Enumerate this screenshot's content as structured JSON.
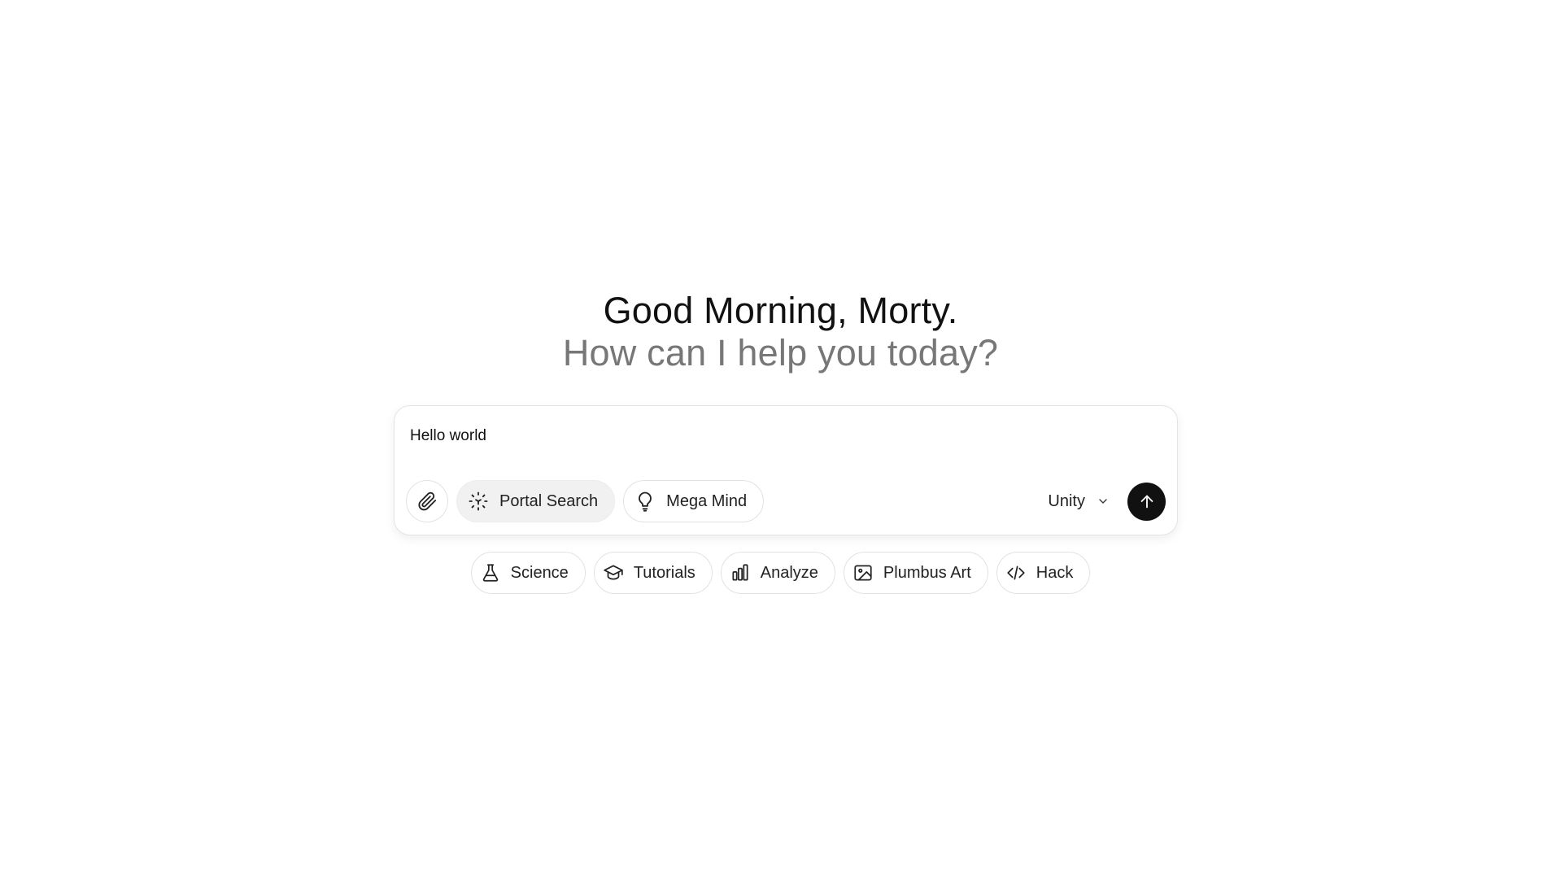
{
  "greeting": {
    "title": "Good Morning, Morty.",
    "subtitle": "How can I help you today?"
  },
  "composer": {
    "input_value": "Hello world",
    "attach_icon": "paperclip-icon",
    "tools": [
      {
        "label": "Portal Search",
        "icon": "portal-search-icon",
        "active": true
      },
      {
        "label": "Mega Mind",
        "icon": "lightbulb-icon",
        "active": false
      }
    ],
    "model": {
      "selected": "Unity",
      "icon": "chevron-down-icon"
    },
    "send_icon": "arrow-up-icon"
  },
  "suggestions": [
    {
      "label": "Science",
      "icon": "flask-icon"
    },
    {
      "label": "Tutorials",
      "icon": "graduation-cap-icon"
    },
    {
      "label": "Analyze",
      "icon": "bar-chart-icon"
    },
    {
      "label": "Plumbus Art",
      "icon": "image-icon"
    },
    {
      "label": "Hack",
      "icon": "code-icon"
    }
  ],
  "colors": {
    "accent": "#111111",
    "muted_text": "#777777",
    "border": "#e2e2e2",
    "active_pill_bg": "#f1f1f1"
  }
}
